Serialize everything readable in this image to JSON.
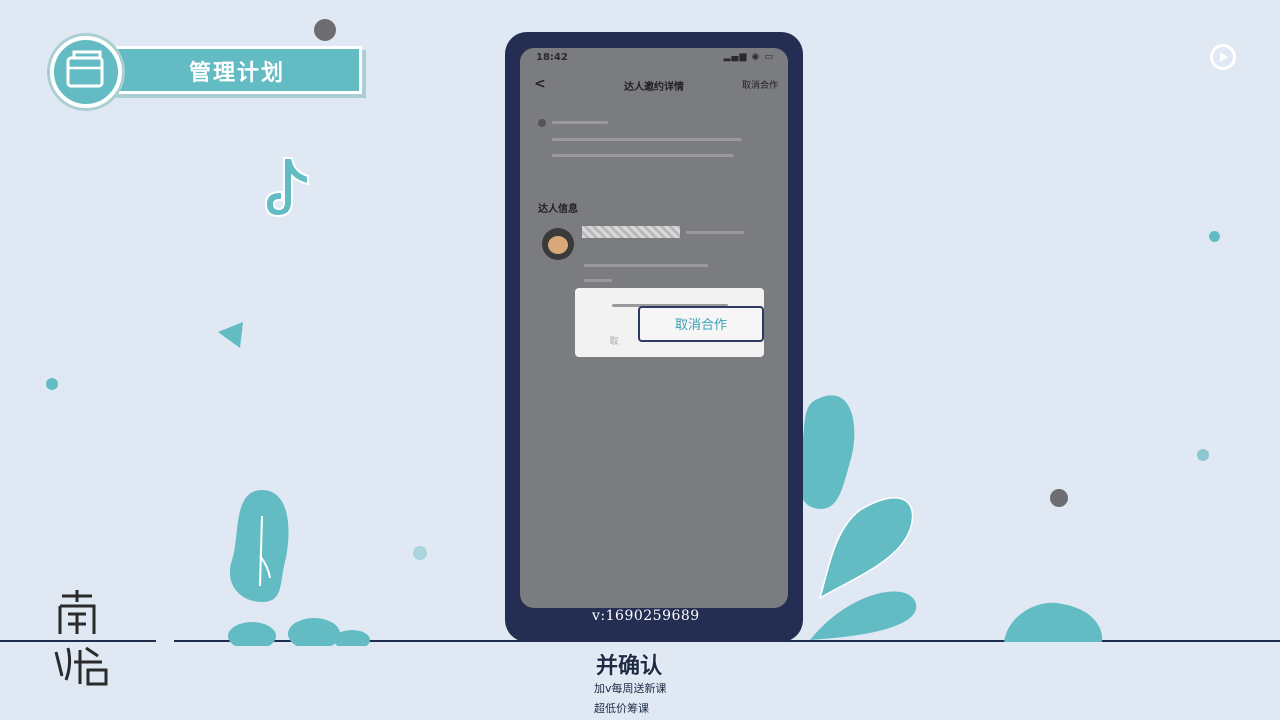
{
  "title_badge": {
    "text": "管理计划"
  },
  "phone": {
    "status_time": "18:42",
    "status_icons": "▂▄▆ ◉ ▭",
    "nav_back": "<",
    "nav_title": "达人邀约详情",
    "nav_action": "取消合作",
    "section_title": "达人信息",
    "dialog": {
      "cancel_label": "取",
      "confirm_label": "取消合作"
    }
  },
  "overlay": {
    "contact": "v:1690259689",
    "subtitle": "并确认",
    "watermark_lines": [
      "加v每周送新课",
      "超低价筹课"
    ]
  },
  "brand": {
    "logo_text": "南\n山悟"
  },
  "colors": {
    "background": "#dfe8f3",
    "accent_teal": "#63bcc4",
    "phone_frame": "#232e52",
    "ground_line": "#1f2d4a"
  }
}
